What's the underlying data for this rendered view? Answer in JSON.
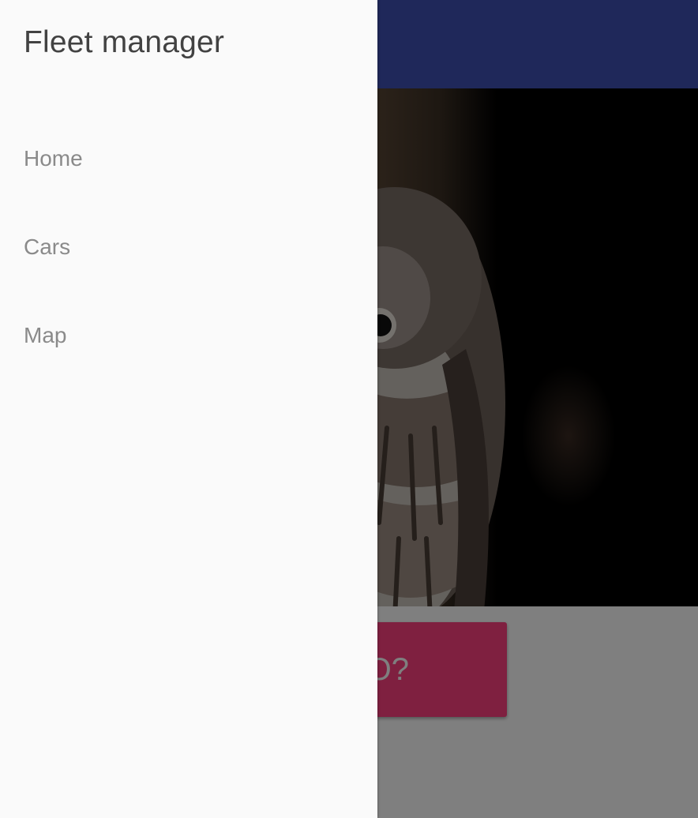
{
  "drawer": {
    "title": "Fleet manager",
    "nav_items": [
      {
        "label": "Home"
      },
      {
        "label": "Cars"
      },
      {
        "label": "Map"
      }
    ]
  },
  "main": {
    "action_button_label": "O?"
  },
  "colors": {
    "app_bar": "#3f51b5",
    "action_button": "#ff4081",
    "drawer_background": "#fafafa"
  }
}
